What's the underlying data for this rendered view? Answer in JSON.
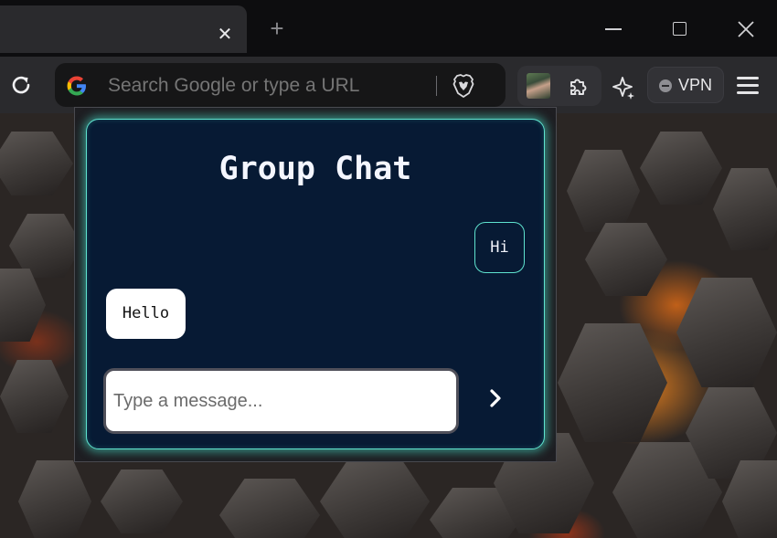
{
  "browser": {
    "tab_close_glyph": "✕",
    "new_tab_glyph": "+",
    "omnibox_placeholder": "Search Google or type a URL",
    "vpn_label": "VPN",
    "icons": [
      "reload-icon",
      "google-icon",
      "brave-shield-icon",
      "profile-avatar",
      "extensions-icon",
      "leo-ai-icon",
      "vpn-icon",
      "menu-icon",
      "minimize-icon",
      "maximize-icon",
      "close-icon"
    ]
  },
  "chat": {
    "title": "Group Chat",
    "messages": [
      {
        "side": "right",
        "text": "Hi"
      },
      {
        "side": "left",
        "text": "Hello"
      }
    ],
    "input_placeholder": "Type a message...",
    "send_icon": "chevron-right-icon",
    "accent_color": "#5fe3cf",
    "panel_color": "#071a34"
  }
}
